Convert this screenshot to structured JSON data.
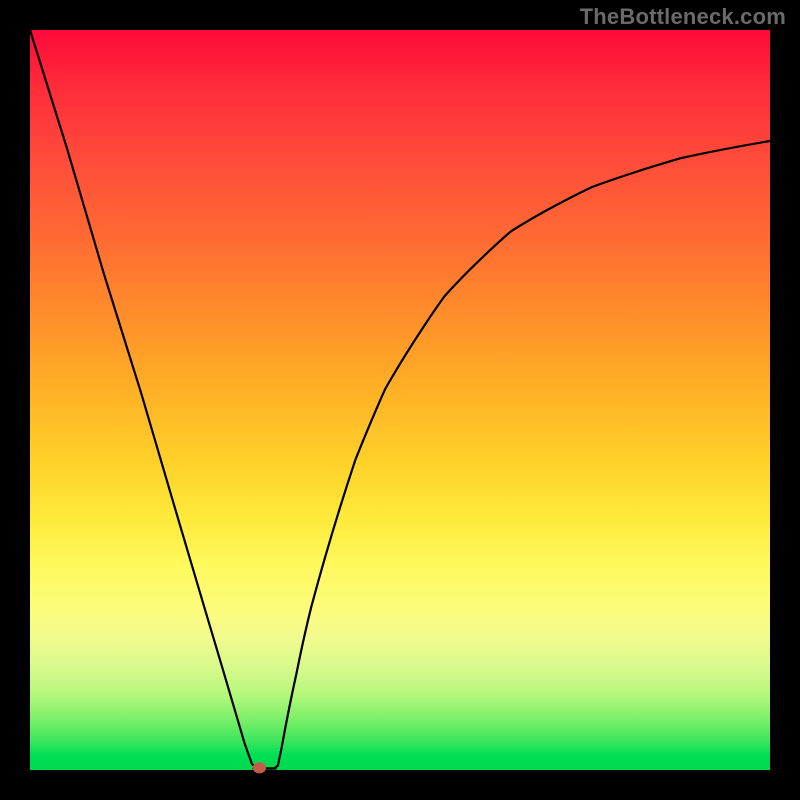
{
  "watermark": "TheBottleneck.com",
  "chart_data": {
    "type": "line",
    "title": "",
    "xlabel": "",
    "ylabel": "",
    "xlim": [
      0,
      100
    ],
    "ylim": [
      0,
      100
    ],
    "series": [
      {
        "name": "bottleneck-curve",
        "x": [
          0,
          5,
          10,
          15,
          20,
          24,
          26,
          28,
          29,
          30,
          30.8,
          31.2,
          33,
          33.5,
          34,
          36,
          38,
          40,
          44,
          48,
          52,
          56,
          60,
          65,
          70,
          76,
          82,
          88,
          94,
          100
        ],
        "y": [
          100,
          84,
          67,
          51,
          34,
          20.5,
          13.8,
          7.0,
          3.6,
          0.8,
          0.2,
          0.2,
          0.2,
          0.6,
          3.0,
          13.0,
          22.0,
          29.5,
          42.0,
          51.5,
          58.5,
          64.0,
          68.5,
          72.8,
          76.0,
          78.8,
          81.0,
          82.7,
          84.0,
          85.0
        ]
      }
    ],
    "marker": {
      "name": "min-point",
      "x": 31.0,
      "y": 0.0,
      "color": "#c65a4a"
    },
    "background_gradient": {
      "direction": "vertical",
      "stops": [
        {
          "pos": 0.0,
          "color": "#ff0a3a"
        },
        {
          "pos": 0.38,
          "color": "#ff8c2a"
        },
        {
          "pos": 0.66,
          "color": "#fdea3a"
        },
        {
          "pos": 0.9,
          "color": "#b2f77a"
        },
        {
          "pos": 1.0,
          "color": "#00d94e"
        }
      ]
    }
  }
}
